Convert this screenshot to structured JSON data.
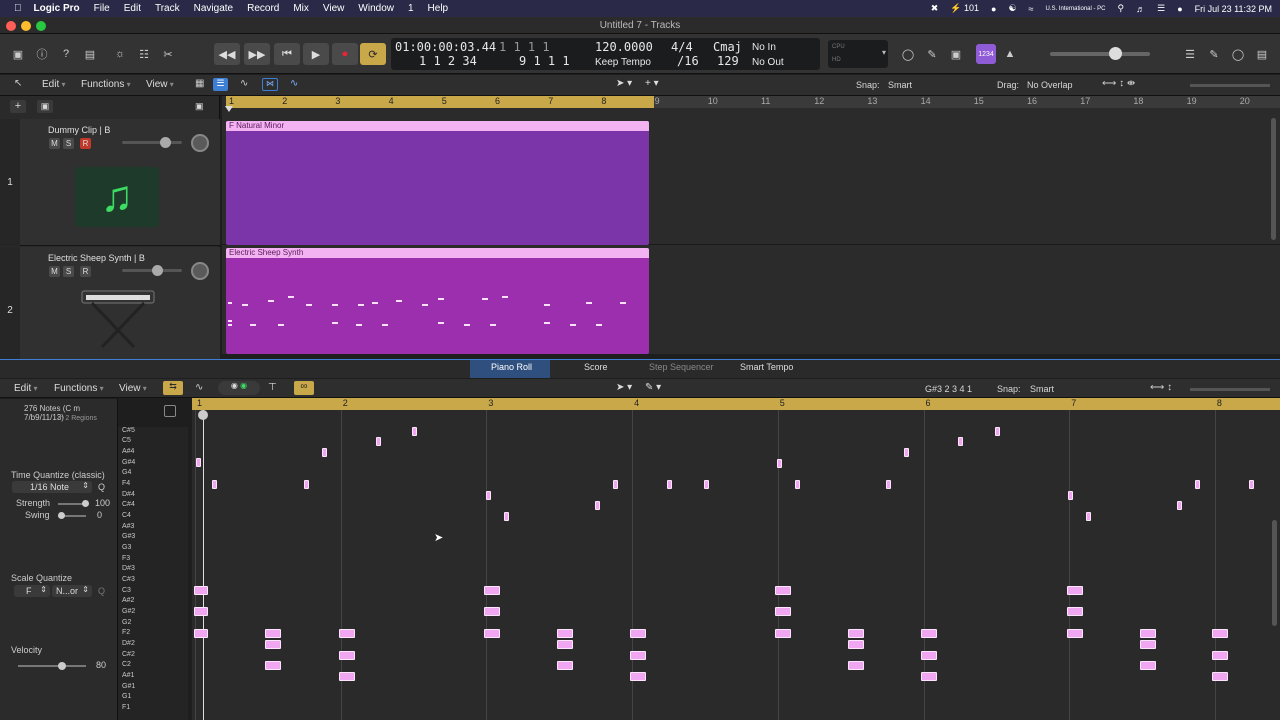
{
  "menubar": {
    "app": "Logic Pro",
    "items": [
      "File",
      "Edit",
      "Track",
      "Navigate",
      "Record",
      "Mix",
      "View",
      "Window",
      "1",
      "Help"
    ],
    "status": {
      "battery": "101",
      "input_source": "U.S. International - PC",
      "clock": "Fri Jul 23  11:32 PM"
    }
  },
  "window": {
    "title": "Untitled 7 - Tracks"
  },
  "lcd": {
    "time": "01:00:00:03.44",
    "time_sub": "1  1  2     34",
    "bars": "1   1   1      1",
    "bars_sub": "9   1   1      1",
    "tempo": "120.0000",
    "tempo_mode": "Keep Tempo",
    "signature": "4/4",
    "division": "/16",
    "key": "Cmaj",
    "key_value": "129",
    "midi_in": "No In",
    "midi_out": "No Out",
    "cpu_label": "CPU",
    "hd_label": "HD"
  },
  "trackbar": {
    "edit": "Edit",
    "functions": "Functions",
    "view": "View",
    "snap_label": "Snap:",
    "snap_value": "Smart",
    "drag_label": "Drag:",
    "drag_value": "No Overlap"
  },
  "ruler": [
    "1",
    "2",
    "3",
    "4",
    "5",
    "6",
    "7",
    "8",
    "9",
    "10",
    "11",
    "12",
    "13",
    "14",
    "15",
    "16",
    "17",
    "18",
    "19",
    "20"
  ],
  "tracks": [
    {
      "number": "1",
      "name": "Dummy Clip  |  B",
      "mute": "M",
      "solo": "S",
      "record": "R",
      "region": "F Natural Minor"
    },
    {
      "number": "2",
      "name": "Electric Sheep Synth  |  B",
      "mute": "M",
      "solo": "S",
      "record": "R",
      "region": "Electric Sheep Synth"
    }
  ],
  "editor_tabs": [
    "Piano Roll",
    "Score",
    "Step Sequencer",
    "Smart Tempo"
  ],
  "prbar": {
    "edit": "Edit",
    "functions": "Functions",
    "view": "View",
    "position": "G#3  2 3 4 1",
    "snap_label": "Snap:",
    "snap_value": "Smart"
  },
  "inspector": {
    "notes": "276 Notes (C m 7/b9/11/13)",
    "regions": "in 2 Regions",
    "tq_title": "Time Quantize (classic)",
    "tq_value": "1/16 Note",
    "tq_q": "Q",
    "strength_label": "Strength",
    "strength_value": "100",
    "swing_label": "Swing",
    "swing_value": "0",
    "sq_title": "Scale Quantize",
    "sq_root": "F",
    "sq_scale": "N...or",
    "sq_q": "Q",
    "velocity_label": "Velocity",
    "velocity_value": "80"
  },
  "pr_ruler": [
    "1",
    "2",
    "3",
    "4",
    "5",
    "6",
    "7",
    "8"
  ],
  "keys": [
    "C#5",
    "C5",
    "A#4",
    "G#4",
    "G4",
    "F4",
    "D#4",
    "C#4",
    "C4",
    "A#3",
    "G#3",
    "G3",
    "F3",
    "D#3",
    "C#3",
    "C3",
    "A#2",
    "G#2",
    "G2",
    "F2",
    "D#2",
    "C#2",
    "C2",
    "A#1",
    "G#1",
    "G1",
    "F1"
  ],
  "colors": {
    "region_header": "#f3b3f3",
    "region_body_1": "#7b35a8",
    "region_body_2": "#9b2fae",
    "note": "#f0a6f0",
    "cycle": "#c9a84a",
    "accent": "#3e7fd6"
  }
}
